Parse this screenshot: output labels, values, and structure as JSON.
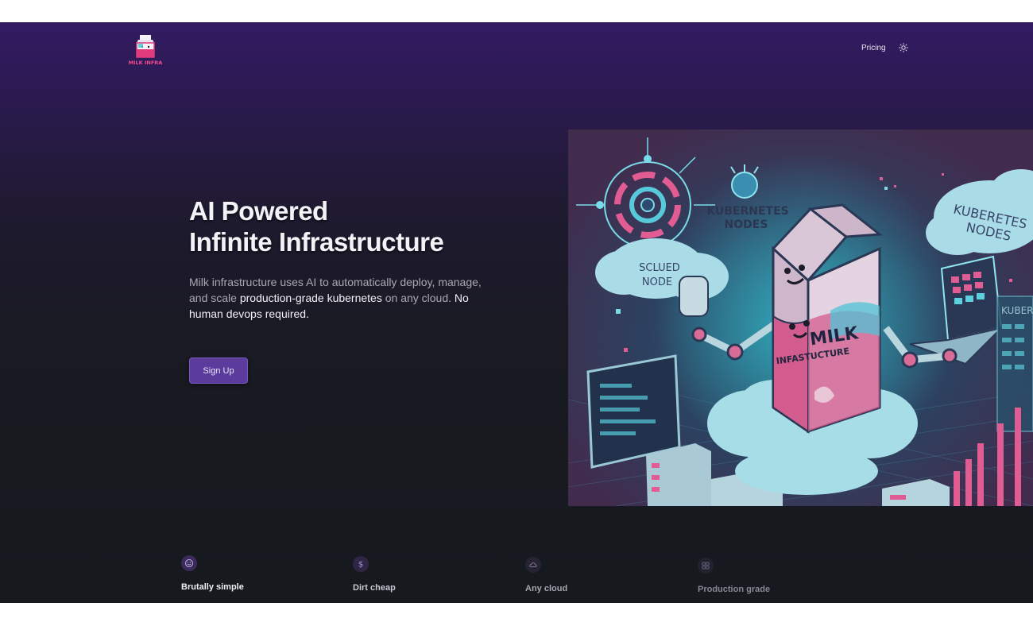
{
  "header": {
    "logo_text": "MILK INFRA",
    "nav": {
      "pricing": "Pricing"
    },
    "theme_toggle_icon": "sun-icon"
  },
  "hero": {
    "title_line1": "AI Powered",
    "title_line2": "Infinite Infrastructure",
    "desc_part1": "Milk infrastructure uses AI to automatically deploy, manage, and scale ",
    "desc_highlight1": "production-grade kubernetes",
    "desc_part2": " on any cloud. ",
    "desc_highlight2": "No human devops required.",
    "signup_label": "Sign Up",
    "illustration": {
      "carton_text_1": "MILK",
      "carton_text_2": "INFASTUCTURE",
      "label_nodes_1": "KUBERNETES NODES",
      "label_nodes_2": "KUBERETES NODES",
      "label_scaled": "SCLUED NODE",
      "label_side": "KUBER"
    }
  },
  "features": [
    {
      "label": "Brutally simple",
      "icon": "smile-icon"
    },
    {
      "label": "Dirt cheap",
      "icon": "dollar-icon"
    },
    {
      "label": "Any cloud",
      "icon": "cloud-icon"
    },
    {
      "label": "Production grade",
      "icon": "grid-icon"
    }
  ],
  "colors": {
    "accent": "#5b3b9c",
    "background_top": "#331b63",
    "background_bottom": "#16191e",
    "text_primary": "#f3f2f6",
    "text_muted": "#a9a8b2"
  }
}
